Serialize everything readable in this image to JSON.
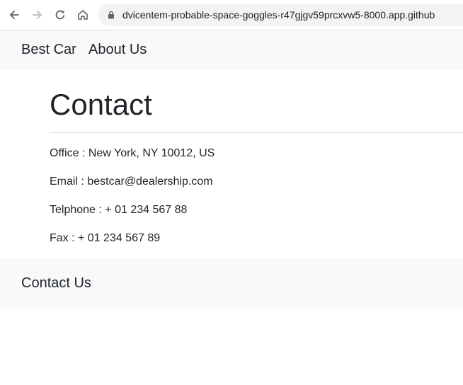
{
  "browser": {
    "url": "dvicentem-probable-space-goggles-r47gjgv59prcxvw5-8000.app.github",
    "icons": {
      "back": "arrow-left-icon",
      "forward": "arrow-right-icon",
      "reload": "reload-icon",
      "home": "home-icon",
      "lock": "lock-icon"
    }
  },
  "navbar": {
    "brand": "Best Car",
    "links": [
      {
        "label": "About Us"
      }
    ]
  },
  "main": {
    "title": "Contact",
    "office": "Office : New York, NY 10012, US",
    "email": "Email : bestcar@dealership.com",
    "phone": "Telphone : + 01 234 567 88",
    "fax": "Fax : + 01 234 567 89"
  },
  "footer": {
    "link": "Contact Us"
  },
  "colors": {
    "navbar_bg": "#f8f9fa",
    "text": "#212529",
    "address_bar_bg": "#f1f3f4"
  }
}
